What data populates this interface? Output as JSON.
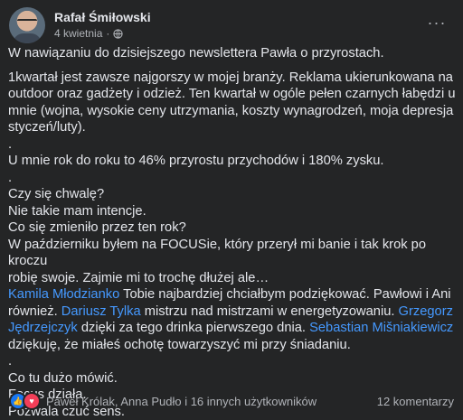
{
  "post": {
    "author": "Rafał Śmiłowski",
    "date": "4 kwietnia",
    "more_label": "···",
    "body": {
      "l1": "W nawiązaniu do dzisiejszego newslettera Pawła o przyrostach.",
      "l2": "1kwartał jest zawsze najgorszy w mojej branży. Reklama ukierunkowana na\noutdoor oraz gadżety i odzież. Ten kwartał w ogóle pełen czarnych łabędzi u\nmnie (wojna, wysokie ceny utrzymania, koszty wynagrodzeń, moja depresja\nstyczeń/luty).\n.",
      "l3": "U mnie rok do roku to 46% przyrostu przychodów i 180% zysku.\n.\nCzy się chwalę?\nNie takie mam intencje.\nCo się zmieniło przez ten rok?\nW październiku byłem na FOCUSie, który przerył mi banie i tak krok po kroczu\nrobię swoje. Zajmie mi to trochę dłużej ale…",
      "mention1": "Kamila Młodzianko",
      "t1": " Tobie najbardziej chciałbym podziękować. Pawłowi i Ani\nrównież. ",
      "mention2": "Dariusz Tylka",
      "t2": " mistrzu nad mistrzami w energetyzowaniu. ",
      "mention3": "Grzegorz\nJędrzejczyk",
      "t3": " dzięki za tego drinka pierwszego dnia. ",
      "mention4": "Sebastian Mišniakiewicz",
      "t4": "\ndziękuję, że miałeś ochotę towarzyszyć mi przy śniadaniu.\n.\nCo tu dużo mówić.\nFocus działa.\nPozwala czuć sens."
    }
  },
  "footer": {
    "reactions_text": "Paweł Królak, Anna Pudło i 16 innych użytkowników",
    "comments_text": "12 komentarzy"
  },
  "icons": {
    "globe": "globe-icon",
    "like": "like-reaction-icon",
    "love": "love-reaction-icon"
  },
  "colors": {
    "background": "#242526",
    "text": "#e4e6eb",
    "secondary": "#b0b3b8",
    "mention": "#4599ff"
  }
}
